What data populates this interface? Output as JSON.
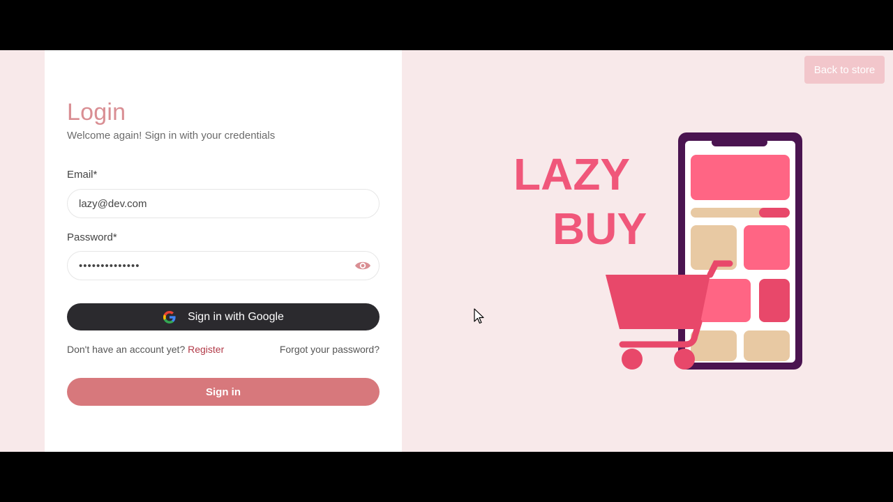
{
  "login": {
    "title": "Login",
    "subtitle": "Welcome again! Sign in with your credentials",
    "email_label": "Email*",
    "email_value": "lazy@dev.com",
    "password_label": "Password*",
    "password_value": "••••••••••••••",
    "google_button_label": "Sign in with Google",
    "no_account_text": "Don't have an account yet?",
    "register_label": "Register",
    "forgot_password_label": "Forgot your password?",
    "signin_button_label": "Sign in"
  },
  "header": {
    "back_to_store_label": "Back to store"
  },
  "illustration": {
    "brand_line1": "LAZY",
    "brand_line2": "BUY"
  },
  "icons": {
    "eye": "eye-icon",
    "google": "google-icon",
    "cursor": "cursor-icon"
  },
  "colors": {
    "accent": "#d98e93",
    "signin_button": "#d7787c",
    "google_button": "#2b2a2e",
    "register_link": "#b23a48",
    "background": "#f8e9ea",
    "brand_pink": "#f0577a",
    "phone_frame": "#4a1450"
  }
}
